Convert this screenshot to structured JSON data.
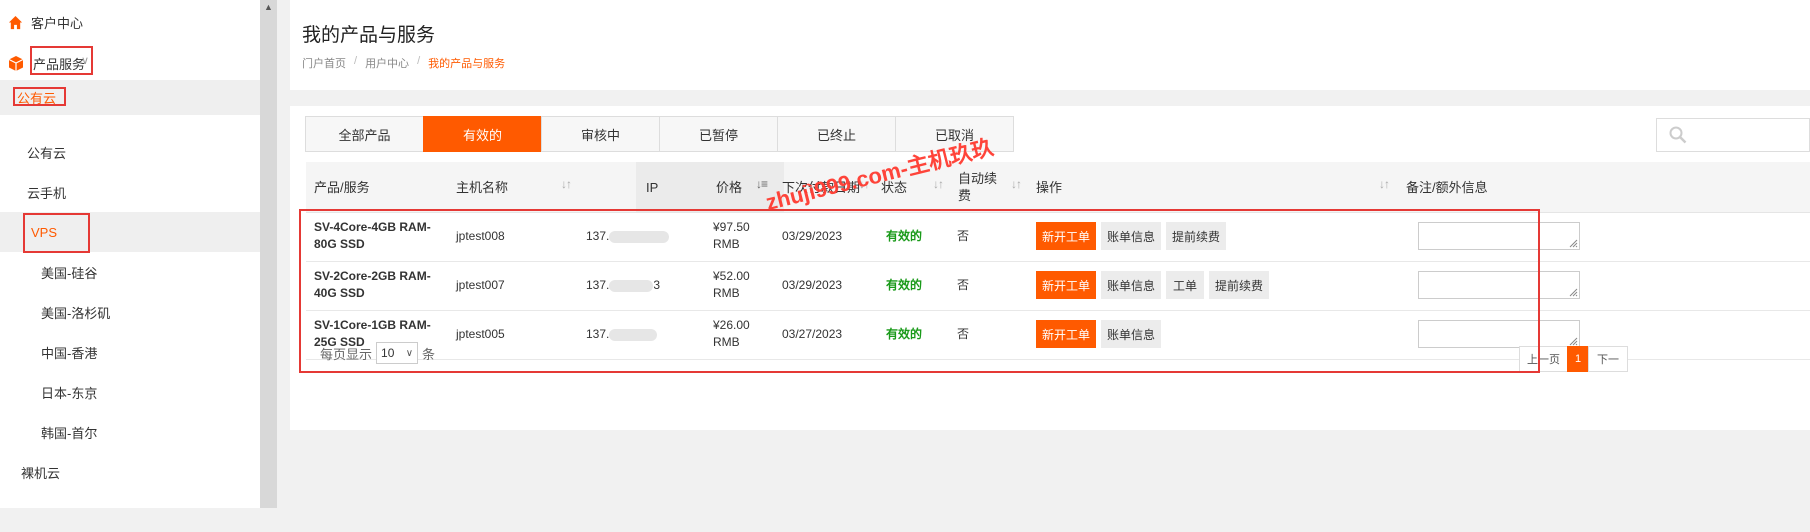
{
  "sidebar": {
    "customer_center": "客户中心",
    "product_services": "产品服务",
    "items": [
      {
        "label": "公有云"
      },
      {
        "label": "公有云"
      },
      {
        "label": "云手机"
      },
      {
        "label": "VPS"
      },
      {
        "label": "美国-硅谷"
      },
      {
        "label": "美国-洛杉矶"
      },
      {
        "label": "中国-香港"
      },
      {
        "label": "日本-东京"
      },
      {
        "label": "韩国-首尔"
      },
      {
        "label": "裸机云"
      }
    ]
  },
  "header": {
    "title": "我的产品与服务",
    "breadcrumb": [
      "门户首页",
      "用户中心",
      "我的产品与服务"
    ],
    "separator": "/"
  },
  "tabs": [
    {
      "label": "全部产品",
      "active": false
    },
    {
      "label": "有效的",
      "active": true
    },
    {
      "label": "审核中",
      "active": false
    },
    {
      "label": "已暂停",
      "active": false
    },
    {
      "label": "已终止",
      "active": false
    },
    {
      "label": "已取消",
      "active": false
    }
  ],
  "search": {
    "icon": "search-icon"
  },
  "table": {
    "columns": [
      "产品/服务",
      "主机名称",
      "IP",
      "价格",
      "下次付款日期",
      "状态",
      "自动续费",
      "操作",
      "备注/额外信息"
    ],
    "rows": [
      {
        "product": "SV-4Core-4GB RAM-80G SSD",
        "hostname": "jptest008",
        "ip": "137.",
        "price": "¥97.50 RMB",
        "next_due": "03/29/2023",
        "status": "有效的",
        "auto_renew": "否",
        "actions": [
          "新开工单",
          "账单信息",
          "提前续费"
        ]
      },
      {
        "product": "SV-2Core-2GB RAM-40G SSD",
        "hostname": "jptest007",
        "ip": "137.",
        "ip_suffix": "3",
        "price": "¥52.00 RMB",
        "next_due": "03/29/2023",
        "status": "有效的",
        "auto_renew": "否",
        "actions": [
          "新开工单",
          "账单信息",
          "工单",
          "提前续费"
        ]
      },
      {
        "product": "SV-1Core-1GB RAM-25G SSD",
        "hostname": "jptest005",
        "ip": "137.",
        "price": "¥26.00 RMB",
        "next_due": "03/27/2023",
        "status": "有效的",
        "auto_renew": "否",
        "actions": [
          "新开工单",
          "账单信息"
        ]
      }
    ]
  },
  "pagination": {
    "per_page_label": "每页显示",
    "per_page_value": "10",
    "per_page_unit": "条",
    "prev": "上一页",
    "current": "1",
    "next": "下一"
  },
  "watermark": "zhujì999.com-主机玖玖",
  "colors": {
    "accent": "#ff5a00",
    "status_green": "#1a9a1a",
    "highlight_red": "#e53935"
  }
}
